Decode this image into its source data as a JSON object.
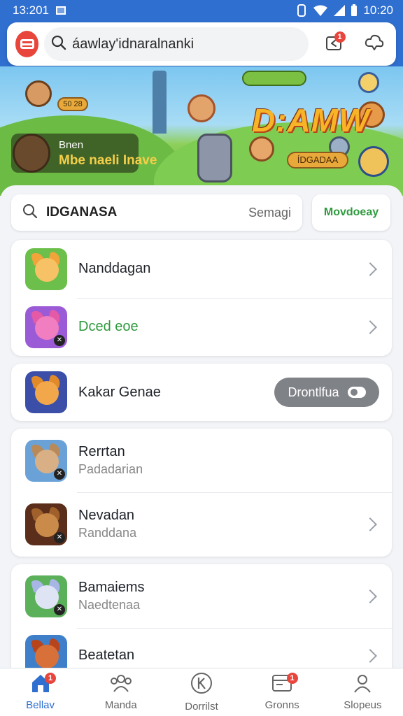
{
  "status_bar": {
    "time_left": "13:201",
    "time_right": "10:20"
  },
  "header": {
    "search_text": "áawlay'idnaralnanki",
    "icons": [
      "app-logo-icon",
      "search-icon",
      "share-icon",
      "cloud-icon"
    ],
    "share_badge": "1"
  },
  "banner": {
    "title": "D:AMW",
    "profile_name": "Bnen",
    "profile_status": "Mbe naeli Inave",
    "chip_left": "50 28",
    "chip_right": "ÍDGADAA"
  },
  "filter": {
    "title": "IDGANASA",
    "sort_label": "Semagi",
    "move_label": "Movdoeay"
  },
  "groups": [
    {
      "rows": [
        {
          "title": "Nanddagan",
          "sub": "",
          "icon": "fox-icon",
          "title_color": "default"
        },
        {
          "title": "Dced eoe",
          "sub": "",
          "icon": "pink-cat-icon",
          "title_color": "green"
        }
      ]
    },
    {
      "rows": [
        {
          "title": "Kakar Genae",
          "sub": "",
          "icon": "dog-icon",
          "button": "Drontlfua"
        }
      ]
    },
    {
      "rows": [
        {
          "title": "Rerrtan",
          "sub": "Padadarian",
          "icon": "cat-icon"
        },
        {
          "title": "Nevadan",
          "sub": "Randdana",
          "icon": "bear-icon"
        }
      ]
    },
    {
      "rows": [
        {
          "title": "Bamaiems",
          "sub": "Naedtenaa",
          "icon": "white-cat-icon"
        },
        {
          "title": "Beatetan",
          "sub": "",
          "icon": "red-fox-icon"
        }
      ]
    }
  ],
  "bottom_nav": [
    {
      "label": "Bellav",
      "icon": "home-icon",
      "badge": "1",
      "active": true
    },
    {
      "label": "Manda",
      "icon": "people-icon",
      "badge": "",
      "active": false
    },
    {
      "label": "Dorrilst",
      "icon": "k-circle-icon",
      "badge": "",
      "active": false
    },
    {
      "label": "Gronns",
      "icon": "inbox-icon",
      "badge": "1",
      "active": false
    },
    {
      "label": "Slopeus",
      "icon": "profile-icon",
      "badge": "",
      "active": false
    }
  ],
  "colors": {
    "primary": "#2f6fd0",
    "accent_red": "#e8453c",
    "accent_green": "#2f9a3e",
    "banner_title": "#f6b426"
  }
}
